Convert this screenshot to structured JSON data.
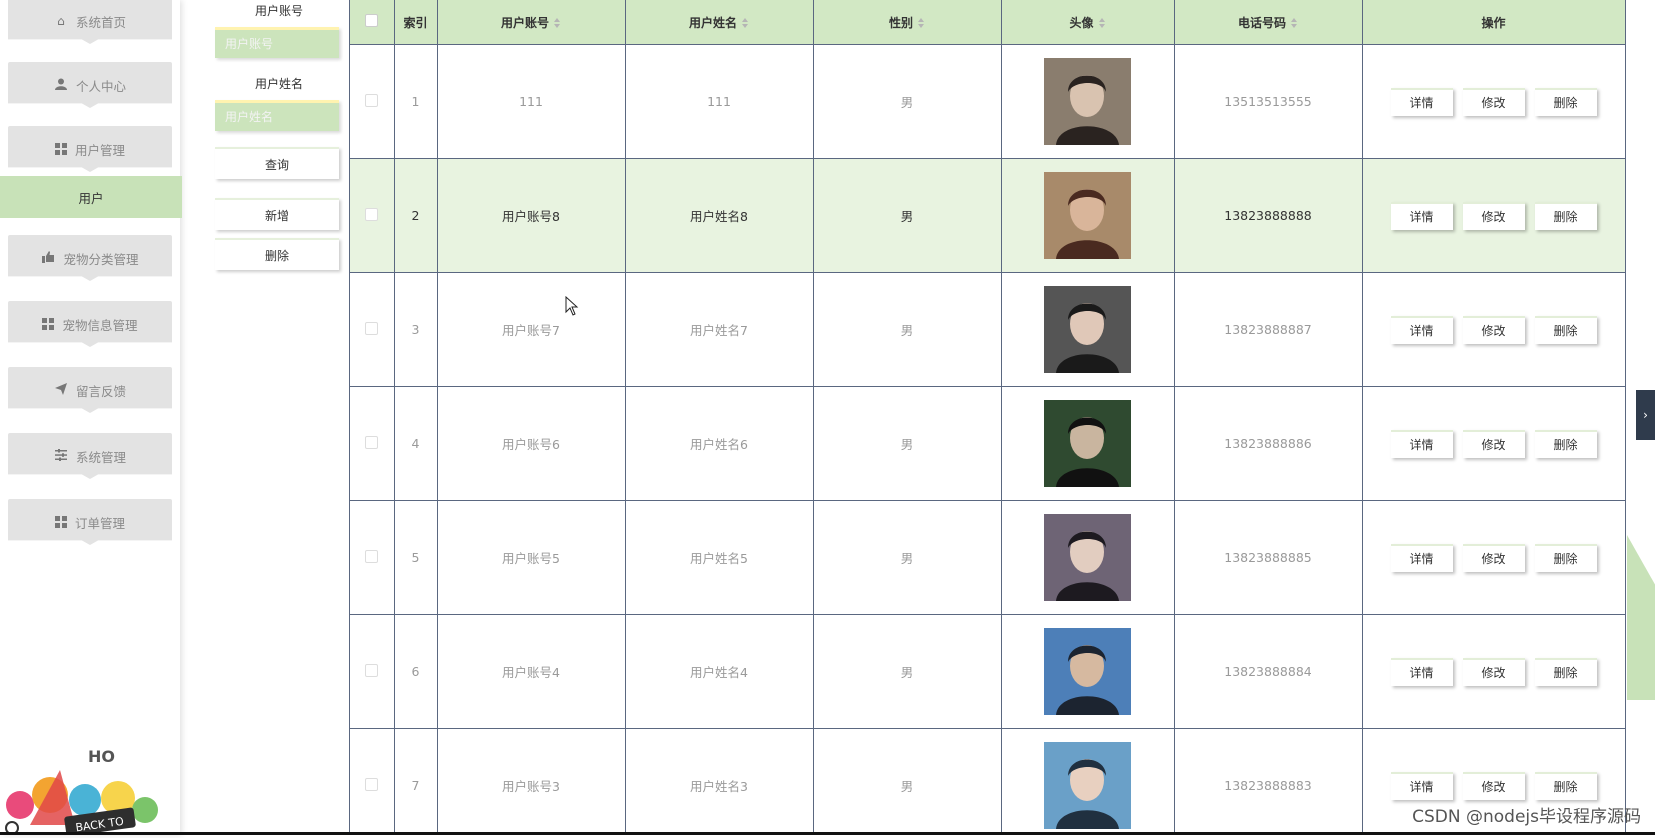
{
  "sidebar": {
    "items": [
      {
        "label": "系统首页",
        "icon": "home-icon"
      },
      {
        "label": "个人中心",
        "icon": "user-icon"
      },
      {
        "label": "用户管理",
        "icon": "grid-icon"
      },
      {
        "label": "用户",
        "icon": ""
      },
      {
        "label": "宠物分类管理",
        "icon": "thumb-icon"
      },
      {
        "label": "宠物信息管理",
        "icon": "grid-icon"
      },
      {
        "label": "留言反馈",
        "icon": "send-icon"
      },
      {
        "label": "系统管理",
        "icon": "sliders-icon"
      },
      {
        "label": "订单管理",
        "icon": "grid-icon"
      }
    ],
    "active_color": "#c8e2b8"
  },
  "filter": {
    "account_label": "用户账号",
    "account_placeholder": "用户账号",
    "name_label": "用户姓名",
    "name_placeholder": "用户姓名",
    "query_label": "查询",
    "add_label": "新增",
    "delete_label": "删除"
  },
  "table": {
    "headers": {
      "index": "索引",
      "account": "用户账号",
      "name": "用户姓名",
      "gender": "性别",
      "avatar": "头像",
      "phone": "电话号码",
      "ops": "操作"
    },
    "rows": [
      {
        "index": "1",
        "account": "111",
        "name": "111",
        "gender": "男",
        "phone": "13513513555"
      },
      {
        "index": "2",
        "account": "用户账号8",
        "name": "用户姓名8",
        "gender": "男",
        "phone": "13823888888"
      },
      {
        "index": "3",
        "account": "用户账号7",
        "name": "用户姓名7",
        "gender": "男",
        "phone": "13823888887"
      },
      {
        "index": "4",
        "account": "用户账号6",
        "name": "用户姓名6",
        "gender": "男",
        "phone": "13823888886"
      },
      {
        "index": "5",
        "account": "用户账号5",
        "name": "用户姓名5",
        "gender": "男",
        "phone": "13823888885"
      },
      {
        "index": "6",
        "account": "用户账号4",
        "name": "用户姓名4",
        "gender": "男",
        "phone": "13823888884"
      },
      {
        "index": "7",
        "account": "用户账号3",
        "name": "用户姓名3",
        "gender": "男",
        "phone": "13823888883"
      }
    ],
    "ops": {
      "detail": "详情",
      "edit": "修改",
      "delete": "删除"
    },
    "header_color": "#d2e8c4"
  },
  "logo": {
    "text": "BACK TO",
    "text2": "HO"
  },
  "watermark": "CSDN @nodejs毕设程序源码"
}
